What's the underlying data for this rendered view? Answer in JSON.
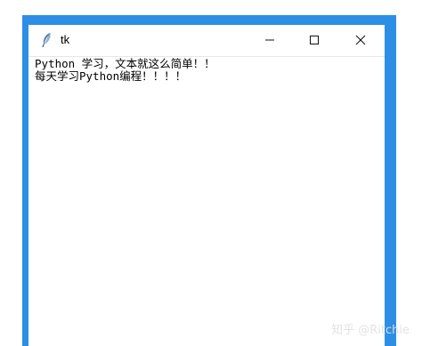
{
  "window": {
    "title": "tk",
    "controls": {
      "minimize_icon": "minimize-icon",
      "maximize_icon": "maximize-icon",
      "close_icon": "close-icon"
    },
    "frame_color": "#2d8ee6"
  },
  "content": {
    "lines": [
      "Python 学习，文本就这么简单！！",
      "每天学习Python编程！！！！"
    ]
  },
  "watermark": {
    "text": "知乎 @Ritchie"
  }
}
